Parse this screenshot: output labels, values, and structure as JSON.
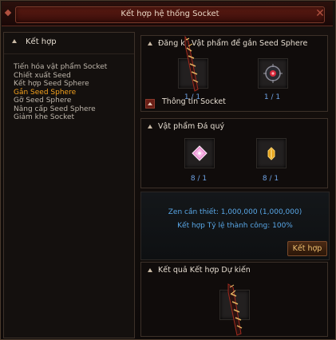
{
  "window": {
    "title": "Kết hợp hệ thống Socket"
  },
  "sidebar": {
    "heading": "Kết hợp",
    "items": [
      {
        "label": "Tiến hóa vật phẩm Socket",
        "active": false
      },
      {
        "label": "Chiết xuất Seed",
        "active": false
      },
      {
        "label": "Kết hợp Seed Sphere",
        "active": false
      },
      {
        "label": "Gắn Seed Sphere",
        "active": true
      },
      {
        "label": "Gỡ Seed Sphere",
        "active": false
      },
      {
        "label": "Nâng cấp Seed Sphere",
        "active": false
      },
      {
        "label": "Giảm khe Socket",
        "active": false
      }
    ]
  },
  "register_panel": {
    "heading": "Đăng ký Vật phẩm để gắn Seed Sphere",
    "slot1_count": "1 / 1",
    "slot2_count": "1 / 1",
    "socket_info_label": "Thông tin Socket"
  },
  "jewel_panel": {
    "heading": "Vật phẩm Đá quý",
    "slot1_count": "8 / 1",
    "slot2_count": "8 / 1"
  },
  "requirements": {
    "zen_required": "Zen cần thiết: 1,000,000 (1,000,000)",
    "success_rate": "Kết hợp Tỷ lệ thành công: 100%"
  },
  "actions": {
    "combine_label": "Kết hợp"
  },
  "result_panel": {
    "heading": "Kết quả Kết hợp Dự kiến"
  },
  "colors": {
    "active_menu": "#f3a11e",
    "count_text": "#6ea3e6",
    "info_text": "#59a7e7",
    "button_text": "#f0c070"
  },
  "icons": [
    "close-icon",
    "sword-icon",
    "seed-sphere-icon",
    "pink-jewel-icon",
    "gold-gem-icon"
  ]
}
